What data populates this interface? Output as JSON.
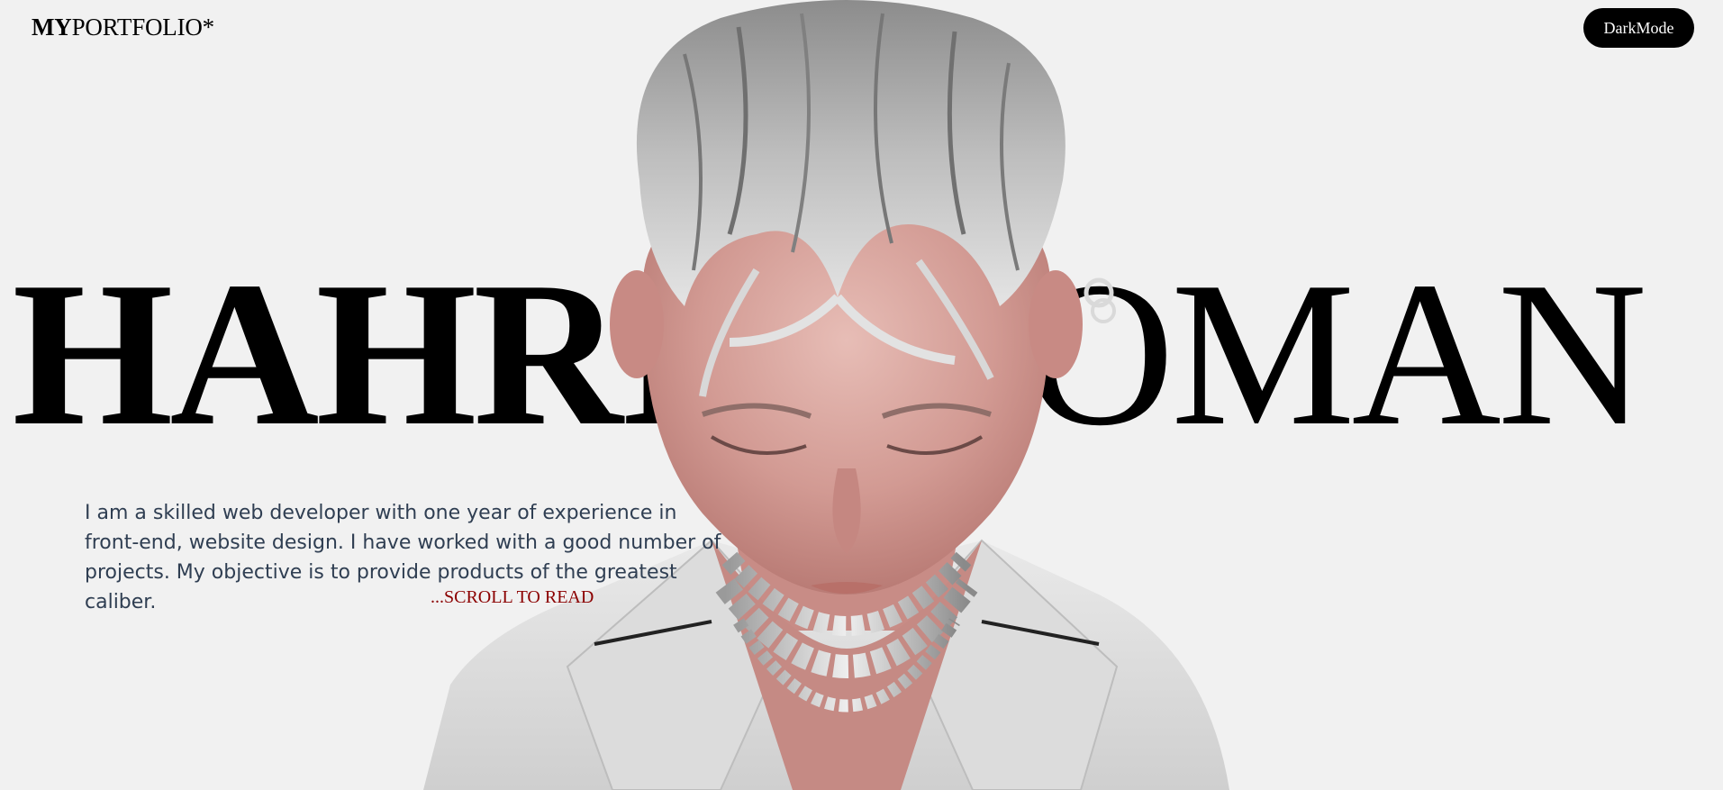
{
  "header": {
    "logo_bold": "MY",
    "logo_regular": "PORTFOLIO*",
    "dark_mode_label": "DarkMode"
  },
  "hero": {
    "name_first_visible": "HAHRI",
    "name_last_visible": "OMAN",
    "intro_text": "I am a skilled web developer with one year of experience in front-end, website design. I have worked with a good number of projects. My objective is to provide products of the greatest caliber.",
    "scroll_label": "...SCROLL TO READ",
    "portrait_icon": "3d-avatar-portrait"
  },
  "colors": {
    "background": "#f1f1f1",
    "text": "#000000",
    "intro_text": "#2f3e52",
    "accent": "#8b0000",
    "button_bg": "#000000",
    "button_text": "#ffffff"
  }
}
